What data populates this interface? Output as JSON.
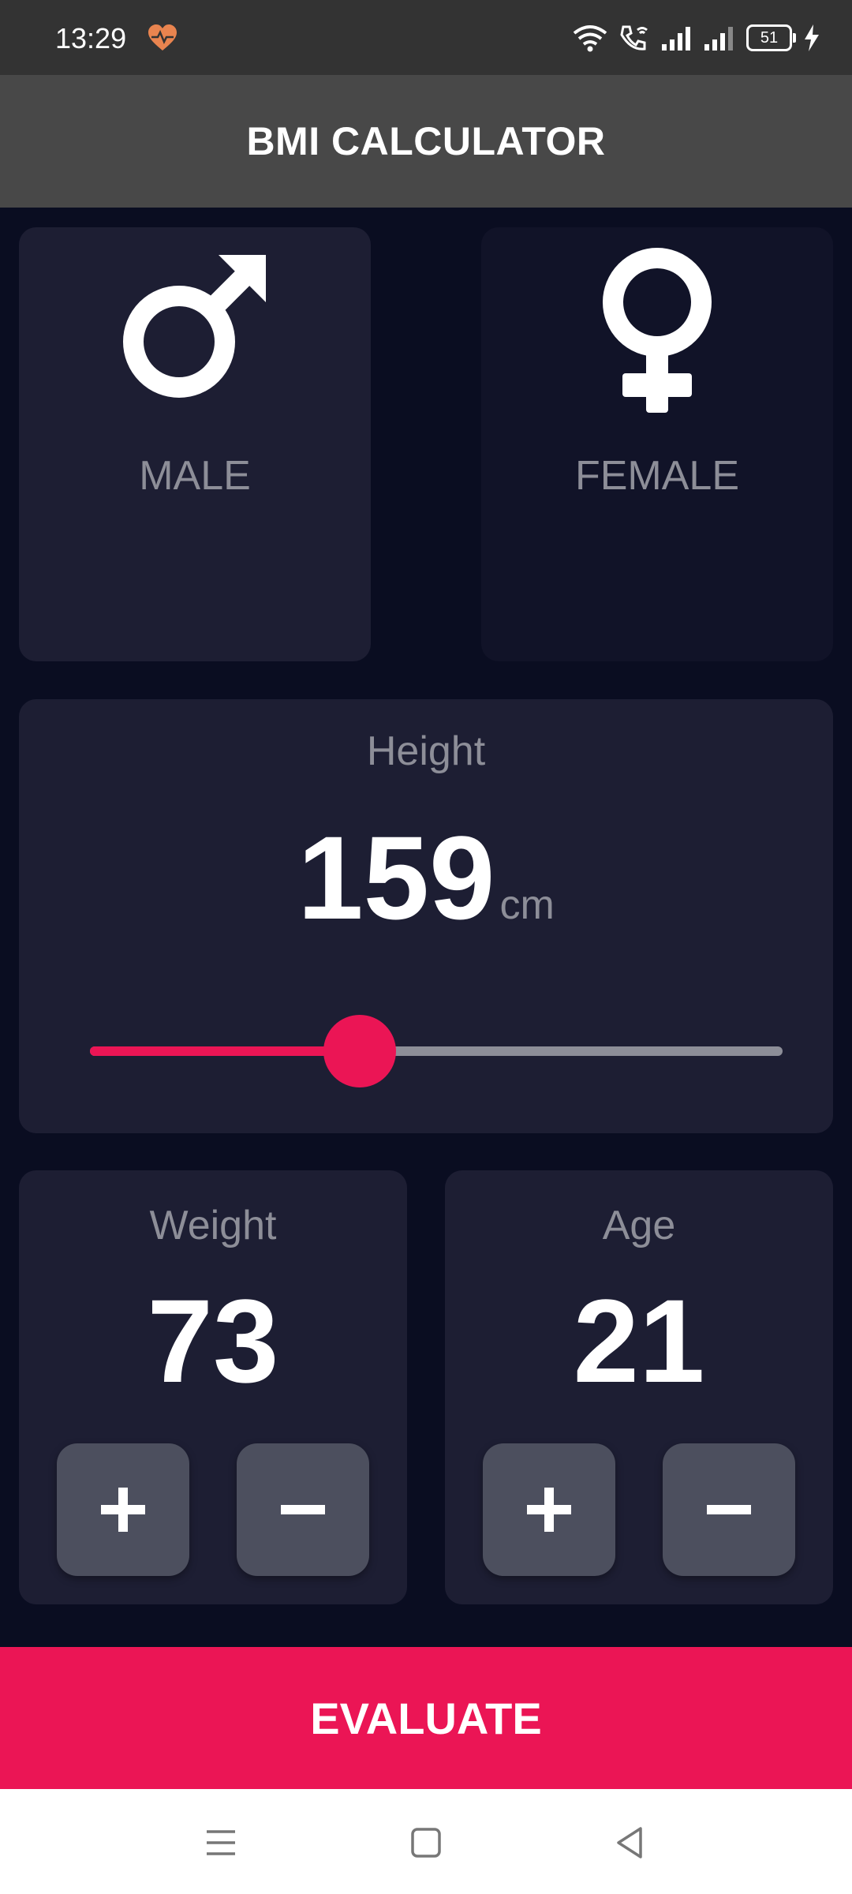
{
  "status_bar": {
    "time": "13:29",
    "battery": "51",
    "icons": [
      "heart-rate-icon",
      "wifi-icon",
      "wifi-calling-icon",
      "signal-icon",
      "signal-icon",
      "battery-icon",
      "charging-icon"
    ]
  },
  "app_bar": {
    "title": "BMI CALCULATOR"
  },
  "gender": {
    "male_label": "MALE",
    "female_label": "FEMALE",
    "selected": "MALE"
  },
  "height": {
    "label": "Height",
    "value": "159",
    "unit": "cm",
    "slider_fraction": 0.39
  },
  "weight": {
    "label": "Weight",
    "value": "73"
  },
  "age": {
    "label": "Age",
    "value": "21"
  },
  "evaluate_label": "EVALUATE",
  "colors": {
    "background": "#0a0d21",
    "card": "#1d1e33",
    "accent": "#eb1555",
    "label": "#8d8e98",
    "button": "#4c4f5e"
  }
}
